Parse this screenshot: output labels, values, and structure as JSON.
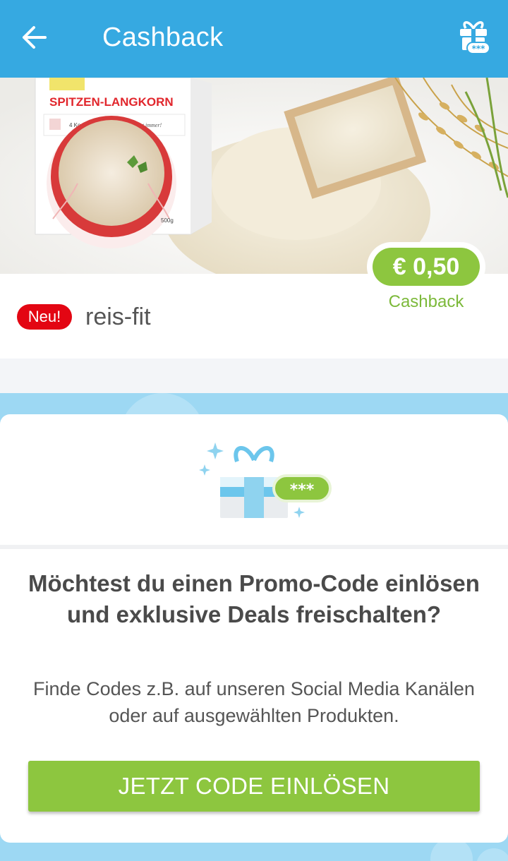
{
  "colors": {
    "primary": "#36a9e1",
    "accent_green": "#8dc63f",
    "badge_red": "#e30613",
    "band_blue": "#9dd8f3"
  },
  "appbar": {
    "title": "Cashback",
    "back_icon": "arrow-left-icon",
    "gift_icon": "gift-code-icon"
  },
  "hero": {
    "package_title": "SPITZEN-LANGKORN",
    "package_subtitle": "4 Kochbeutel",
    "package_slogan": "Gelingt immer!",
    "package_weight": "500g"
  },
  "product": {
    "badge": "Neu!",
    "brand": "reis-fit",
    "cashback_amount": "€ 0,50",
    "cashback_label": "Cashback"
  },
  "promo": {
    "code_badge": "***",
    "heading": "Möchtest du einen Promo-Code einlösen und exklusive Deals freischalten?",
    "description": "Finde Codes z.B. auf unseren Social Media Kanälen oder auf ausgewählten Produkten.",
    "cta_label": "JETZT CODE EINLÖSEN"
  }
}
